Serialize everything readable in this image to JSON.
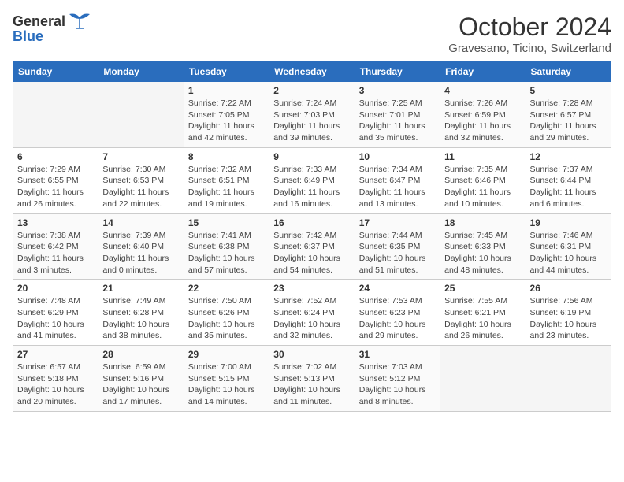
{
  "header": {
    "logo_general": "General",
    "logo_blue": "Blue",
    "month": "October 2024",
    "location": "Gravesano, Ticino, Switzerland"
  },
  "weekdays": [
    "Sunday",
    "Monday",
    "Tuesday",
    "Wednesday",
    "Thursday",
    "Friday",
    "Saturday"
  ],
  "weeks": [
    [
      {
        "day": "",
        "info": ""
      },
      {
        "day": "",
        "info": ""
      },
      {
        "day": "1",
        "info": "Sunrise: 7:22 AM\nSunset: 7:05 PM\nDaylight: 11 hours and 42 minutes."
      },
      {
        "day": "2",
        "info": "Sunrise: 7:24 AM\nSunset: 7:03 PM\nDaylight: 11 hours and 39 minutes."
      },
      {
        "day": "3",
        "info": "Sunrise: 7:25 AM\nSunset: 7:01 PM\nDaylight: 11 hours and 35 minutes."
      },
      {
        "day": "4",
        "info": "Sunrise: 7:26 AM\nSunset: 6:59 PM\nDaylight: 11 hours and 32 minutes."
      },
      {
        "day": "5",
        "info": "Sunrise: 7:28 AM\nSunset: 6:57 PM\nDaylight: 11 hours and 29 minutes."
      }
    ],
    [
      {
        "day": "6",
        "info": "Sunrise: 7:29 AM\nSunset: 6:55 PM\nDaylight: 11 hours and 26 minutes."
      },
      {
        "day": "7",
        "info": "Sunrise: 7:30 AM\nSunset: 6:53 PM\nDaylight: 11 hours and 22 minutes."
      },
      {
        "day": "8",
        "info": "Sunrise: 7:32 AM\nSunset: 6:51 PM\nDaylight: 11 hours and 19 minutes."
      },
      {
        "day": "9",
        "info": "Sunrise: 7:33 AM\nSunset: 6:49 PM\nDaylight: 11 hours and 16 minutes."
      },
      {
        "day": "10",
        "info": "Sunrise: 7:34 AM\nSunset: 6:47 PM\nDaylight: 11 hours and 13 minutes."
      },
      {
        "day": "11",
        "info": "Sunrise: 7:35 AM\nSunset: 6:46 PM\nDaylight: 11 hours and 10 minutes."
      },
      {
        "day": "12",
        "info": "Sunrise: 7:37 AM\nSunset: 6:44 PM\nDaylight: 11 hours and 6 minutes."
      }
    ],
    [
      {
        "day": "13",
        "info": "Sunrise: 7:38 AM\nSunset: 6:42 PM\nDaylight: 11 hours and 3 minutes."
      },
      {
        "day": "14",
        "info": "Sunrise: 7:39 AM\nSunset: 6:40 PM\nDaylight: 11 hours and 0 minutes."
      },
      {
        "day": "15",
        "info": "Sunrise: 7:41 AM\nSunset: 6:38 PM\nDaylight: 10 hours and 57 minutes."
      },
      {
        "day": "16",
        "info": "Sunrise: 7:42 AM\nSunset: 6:37 PM\nDaylight: 10 hours and 54 minutes."
      },
      {
        "day": "17",
        "info": "Sunrise: 7:44 AM\nSunset: 6:35 PM\nDaylight: 10 hours and 51 minutes."
      },
      {
        "day": "18",
        "info": "Sunrise: 7:45 AM\nSunset: 6:33 PM\nDaylight: 10 hours and 48 minutes."
      },
      {
        "day": "19",
        "info": "Sunrise: 7:46 AM\nSunset: 6:31 PM\nDaylight: 10 hours and 44 minutes."
      }
    ],
    [
      {
        "day": "20",
        "info": "Sunrise: 7:48 AM\nSunset: 6:29 PM\nDaylight: 10 hours and 41 minutes."
      },
      {
        "day": "21",
        "info": "Sunrise: 7:49 AM\nSunset: 6:28 PM\nDaylight: 10 hours and 38 minutes."
      },
      {
        "day": "22",
        "info": "Sunrise: 7:50 AM\nSunset: 6:26 PM\nDaylight: 10 hours and 35 minutes."
      },
      {
        "day": "23",
        "info": "Sunrise: 7:52 AM\nSunset: 6:24 PM\nDaylight: 10 hours and 32 minutes."
      },
      {
        "day": "24",
        "info": "Sunrise: 7:53 AM\nSunset: 6:23 PM\nDaylight: 10 hours and 29 minutes."
      },
      {
        "day": "25",
        "info": "Sunrise: 7:55 AM\nSunset: 6:21 PM\nDaylight: 10 hours and 26 minutes."
      },
      {
        "day": "26",
        "info": "Sunrise: 7:56 AM\nSunset: 6:19 PM\nDaylight: 10 hours and 23 minutes."
      }
    ],
    [
      {
        "day": "27",
        "info": "Sunrise: 6:57 AM\nSunset: 5:18 PM\nDaylight: 10 hours and 20 minutes."
      },
      {
        "day": "28",
        "info": "Sunrise: 6:59 AM\nSunset: 5:16 PM\nDaylight: 10 hours and 17 minutes."
      },
      {
        "day": "29",
        "info": "Sunrise: 7:00 AM\nSunset: 5:15 PM\nDaylight: 10 hours and 14 minutes."
      },
      {
        "day": "30",
        "info": "Sunrise: 7:02 AM\nSunset: 5:13 PM\nDaylight: 10 hours and 11 minutes."
      },
      {
        "day": "31",
        "info": "Sunrise: 7:03 AM\nSunset: 5:12 PM\nDaylight: 10 hours and 8 minutes."
      },
      {
        "day": "",
        "info": ""
      },
      {
        "day": "",
        "info": ""
      }
    ]
  ]
}
